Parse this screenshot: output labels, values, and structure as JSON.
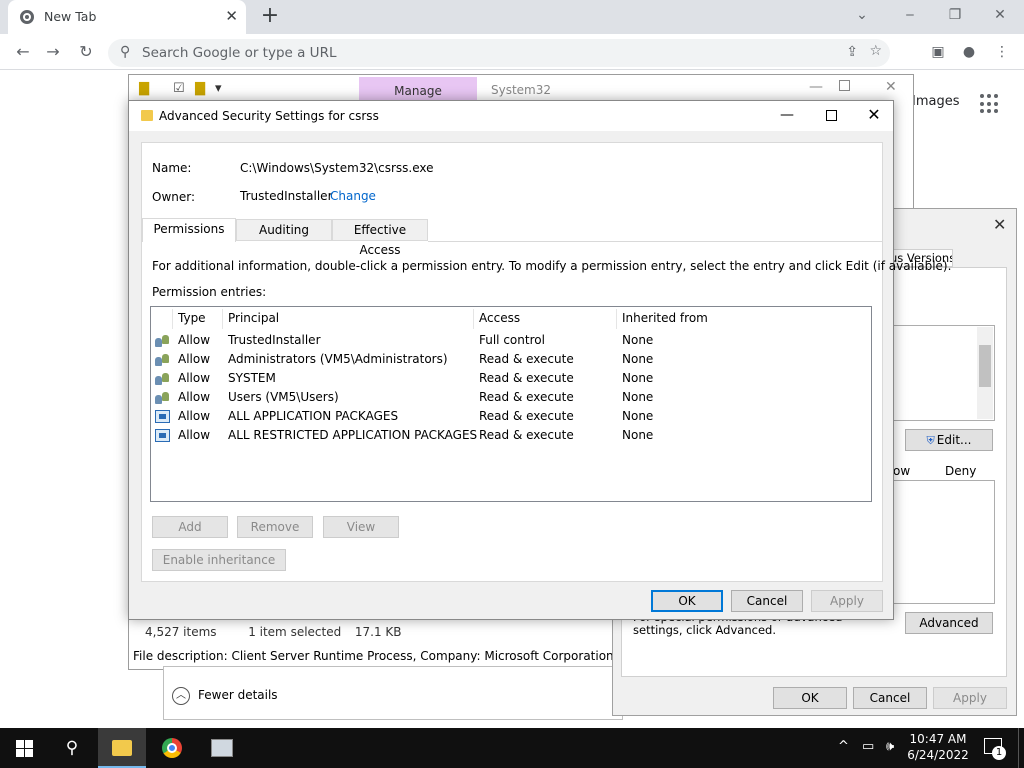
{
  "browser": {
    "tab_title": "New Tab",
    "tab_close": "✕",
    "new_tab": "+",
    "omnibox_placeholder": "Search Google or type a URL",
    "win_minimize": "‒",
    "win_restore": "❐",
    "win_close": "✕",
    "chevron": "⌄"
  },
  "google": {
    "images_link": "Images"
  },
  "explorer": {
    "manage_tab": "Manage",
    "path": "System32",
    "status_items": "4,527 items",
    "status_selected": "1 item selected",
    "status_size": "17.1 KB",
    "file_description": "File description: Client Server Runtime Process, Company: Microsoft Corporation, File versio"
  },
  "taskmgr": {
    "fewer_details": "Fewer details"
  },
  "properties": {
    "tab_previous_versions": "us Versions",
    "edit_button": "Edit...",
    "allow_header": "ow",
    "deny_header": "Deny",
    "note": "For special permissions or advanced settings, click Advanced.",
    "advanced_button": "Advanced",
    "ok": "OK",
    "cancel": "Cancel",
    "apply": "Apply"
  },
  "advanced_security": {
    "title": "Advanced Security Settings for csrss",
    "name_label": "Name:",
    "name_value": "C:\\Windows\\System32\\csrss.exe",
    "owner_label": "Owner:",
    "owner_value": "TrustedInstaller",
    "change_link": "Change",
    "tabs": [
      {
        "label": "Permissions"
      },
      {
        "label": "Auditing"
      },
      {
        "label": "Effective Access"
      }
    ],
    "info_text": "For additional information, double-click a permission entry. To modify a permission entry, select the entry and click Edit (if available).",
    "entries_label": "Permission entries:",
    "columns": {
      "type": "Type",
      "principal": "Principal",
      "access": "Access",
      "inherited": "Inherited from"
    },
    "entries": [
      {
        "icon": "users-icon",
        "type": "Allow",
        "principal": "TrustedInstaller",
        "access": "Full control",
        "inherited": "None"
      },
      {
        "icon": "users-icon",
        "type": "Allow",
        "principal": "Administrators (VM5\\Administrators)",
        "access": "Read & execute",
        "inherited": "None"
      },
      {
        "icon": "users-icon",
        "type": "Allow",
        "principal": "SYSTEM",
        "access": "Read & execute",
        "inherited": "None"
      },
      {
        "icon": "users-icon",
        "type": "Allow",
        "principal": "Users (VM5\\Users)",
        "access": "Read & execute",
        "inherited": "None"
      },
      {
        "icon": "app-package-icon",
        "type": "Allow",
        "principal": "ALL APPLICATION PACKAGES",
        "access": "Read & execute",
        "inherited": "None"
      },
      {
        "icon": "app-package-icon",
        "type": "Allow",
        "principal": "ALL RESTRICTED APPLICATION PACKAGES",
        "access": "Read & execute",
        "inherited": "None"
      }
    ],
    "add_button": "Add",
    "remove_button": "Remove",
    "view_button": "View",
    "enable_inheritance_button": "Enable inheritance",
    "ok": "OK",
    "cancel": "Cancel",
    "apply": "Apply",
    "close_glyph": "✕",
    "minimize_glyph": "—"
  },
  "taskbar": {
    "time": "10:47 AM",
    "date": "6/24/2022",
    "notification_count": "1"
  },
  "colors": {
    "accent": "#0078d7",
    "link": "#0066cc",
    "manage_tab": "#e8c6f3",
    "taskbar": "#101010"
  }
}
